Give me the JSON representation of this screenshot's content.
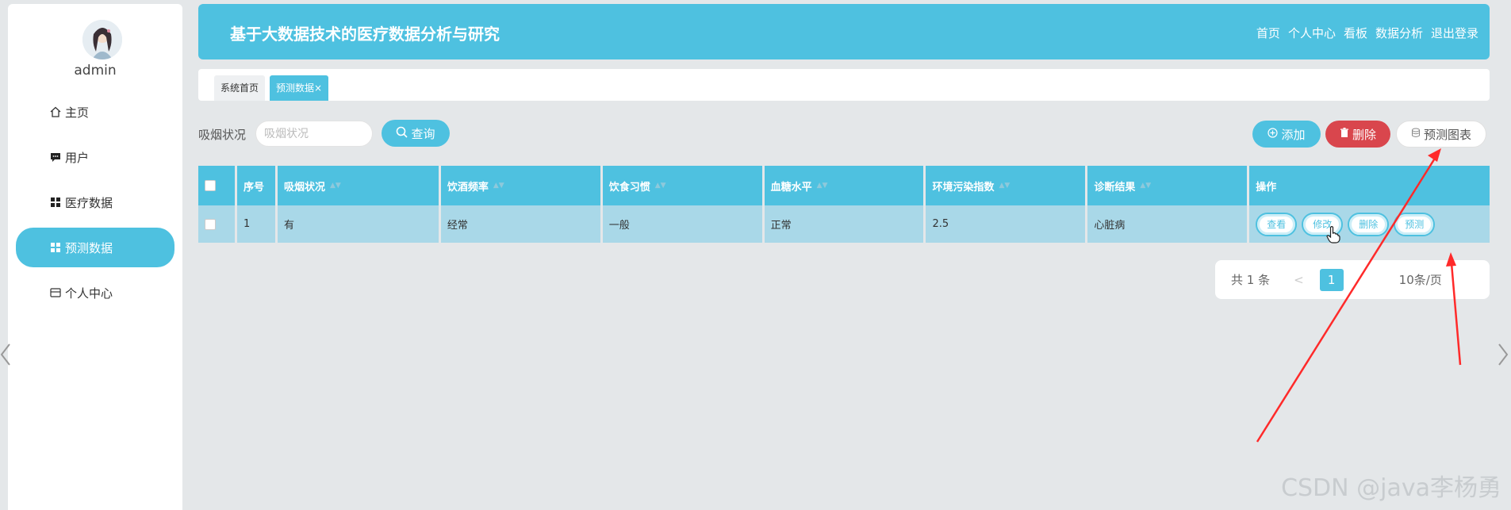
{
  "sidebar": {
    "username": "admin",
    "items": [
      {
        "label": "主页",
        "icon": "home-icon"
      },
      {
        "label": "用户",
        "icon": "message-icon"
      },
      {
        "label": "医疗数据",
        "icon": "grid-icon"
      },
      {
        "label": "预测数据",
        "icon": "grid-icon",
        "active": true
      },
      {
        "label": "个人中心",
        "icon": "card-icon"
      }
    ]
  },
  "header": {
    "title": "基于大数据技术的医疗数据分析与研究",
    "nav": [
      "首页",
      "个人中心",
      "看板",
      "数据分析",
      "退出登录"
    ]
  },
  "tabs": {
    "home": "系统首页",
    "active": "预测数据×"
  },
  "search": {
    "label": "吸烟状况",
    "placeholder": "吸烟状况",
    "button": "查询"
  },
  "actions": {
    "add": "添加",
    "delete": "删除",
    "chart": "预测图表"
  },
  "table": {
    "headers": [
      "序号",
      "吸烟状况",
      "饮酒频率",
      "饮食习惯",
      "血糖水平",
      "环境污染指数",
      "诊断结果",
      "操作"
    ],
    "rows": [
      [
        "1",
        "有",
        "经常",
        "一般",
        "正常",
        "2.5",
        "心脏病"
      ]
    ],
    "row_buttons": [
      "查看",
      "修改",
      "删除",
      "预测"
    ]
  },
  "pagination": {
    "total": "共 1 条",
    "prev": "<",
    "current": "1",
    "page_size": "10条/页"
  },
  "watermark": "CSDN @java李杨勇",
  "colors": {
    "accent": "#4ec1e0",
    "danger": "#d9464d",
    "row_bg": "#a9d8e8",
    "annotation": "#ff2a2a"
  }
}
